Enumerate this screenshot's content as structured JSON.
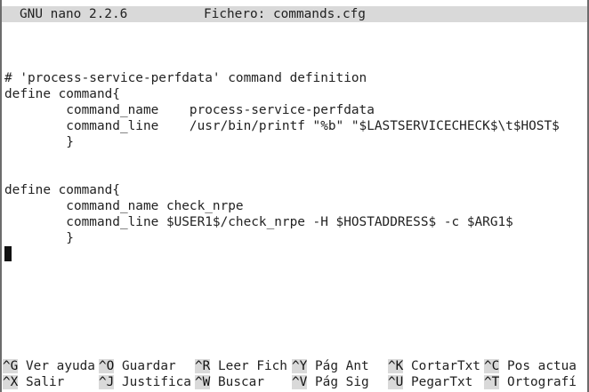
{
  "titlebar": {
    "app": "GNU nano 2.2.6",
    "file": "Fichero: commands.cfg"
  },
  "editor": {
    "lines": [
      "# 'process-service-perfdata' command definition",
      "define command{",
      "        command_name    process-service-perfdata",
      "        command_line    /usr/bin/printf \"%b\" \"$LASTSERVICECHECK$\\t$HOST$",
      "        }",
      "",
      "",
      "define command{",
      "        command_name check_nrpe",
      "        command_line $USER1$/check_nrpe -H $HOSTADDRESS$ -c $ARG1$",
      "        }"
    ]
  },
  "shortcuts": {
    "row1": [
      {
        "key": "^G",
        "label": "Ver ayuda"
      },
      {
        "key": "^O",
        "label": "Guardar"
      },
      {
        "key": "^R",
        "label": "Leer Fich"
      },
      {
        "key": "^Y",
        "label": "Pág Ant"
      },
      {
        "key": "^K",
        "label": "CortarTxt"
      },
      {
        "key": "^C",
        "label": "Pos actua"
      }
    ],
    "row2": [
      {
        "key": "^X",
        "label": "Salir"
      },
      {
        "key": "^J",
        "label": "Justifica"
      },
      {
        "key": "^W",
        "label": "Buscar"
      },
      {
        "key": "^V",
        "label": "Pág Sig"
      },
      {
        "key": "^U",
        "label": "PegarTxt"
      },
      {
        "key": "^T",
        "label": "Ortografí"
      }
    ]
  }
}
